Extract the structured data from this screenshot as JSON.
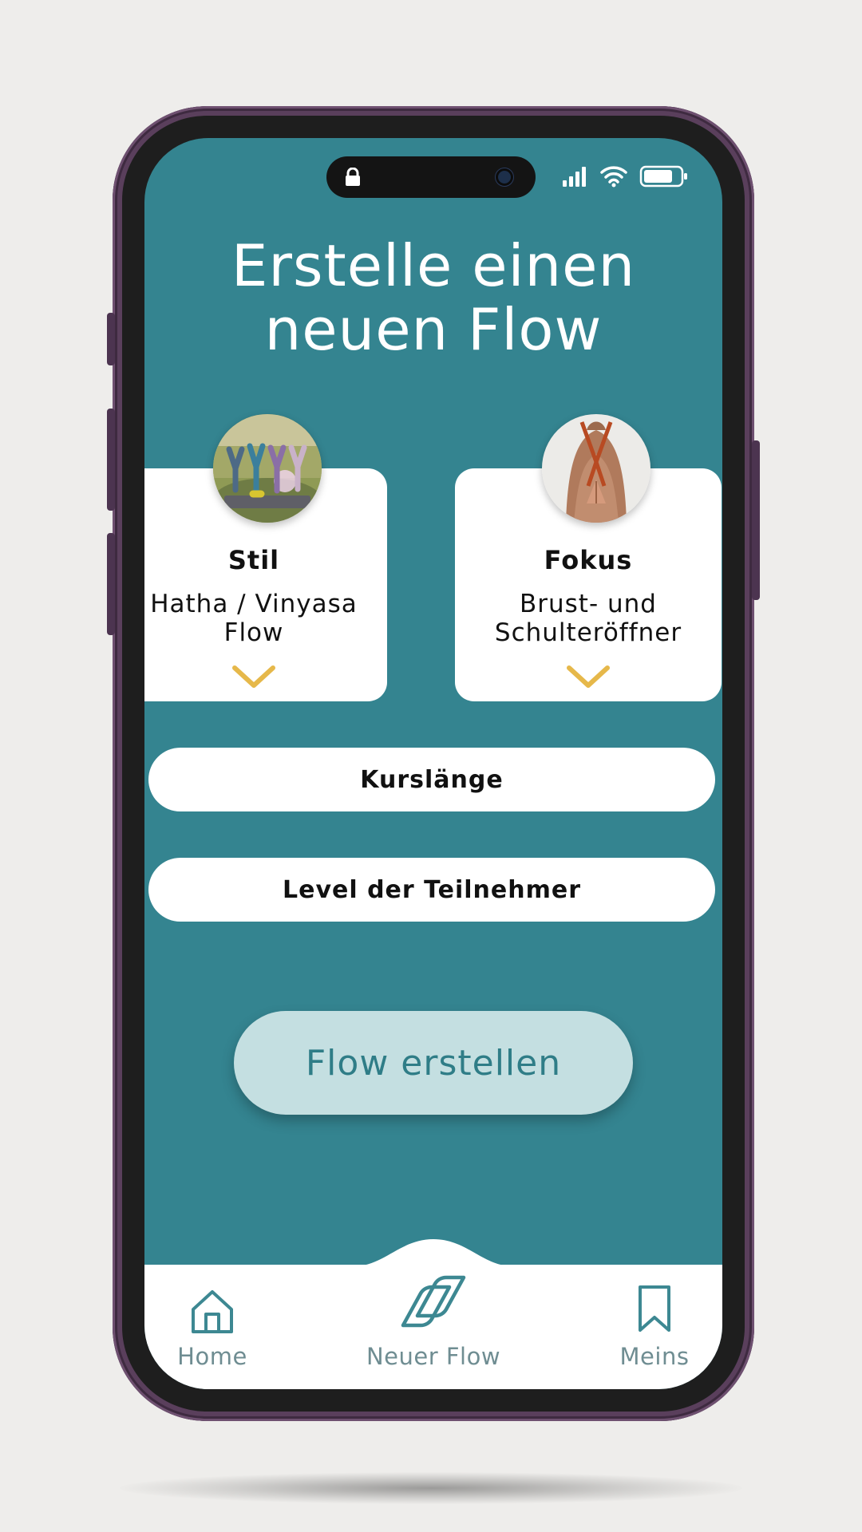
{
  "title": {
    "line1": "Erstelle einen",
    "line2": "neuen Flow"
  },
  "colors": {
    "background": "#eeedeb",
    "screen_teal": "#348490",
    "phone_frame": "#5a3f5c",
    "card_white": "#ffffff",
    "chevron_gold": "#e6b84a",
    "cta_fill": "#c4dfe1",
    "cta_text": "#2f7d87",
    "tab_icon": "#3d8892",
    "tab_label": "#6f8d92"
  },
  "status_bar": {
    "icons": [
      "lock-icon",
      "camera-icon",
      "signal-icon",
      "wifi-icon",
      "battery-icon"
    ]
  },
  "cards": [
    {
      "heading": "Stil",
      "value_line1": "Hatha / Vinyasa",
      "value_line2": "Flow",
      "photo": "group-yoga-outdoors-photo",
      "icon": "chevron-down-icon"
    },
    {
      "heading": "Fokus",
      "value_line1": "Brust- und",
      "value_line2": "Schulteröffner",
      "photo": "back-stretch-photo",
      "icon": "chevron-down-icon"
    }
  ],
  "options": {
    "course_length": "Kurslänge",
    "participant_level": "Level der Teilnehmer"
  },
  "cta": {
    "label": "Flow erstellen"
  },
  "tabbar": {
    "items": [
      {
        "label": "Home",
        "icon": "home-icon"
      },
      {
        "label": "Neuer Flow",
        "icon": "flow-logo-icon",
        "active": true
      },
      {
        "label": "Meins",
        "icon": "bookmark-icon"
      }
    ]
  }
}
